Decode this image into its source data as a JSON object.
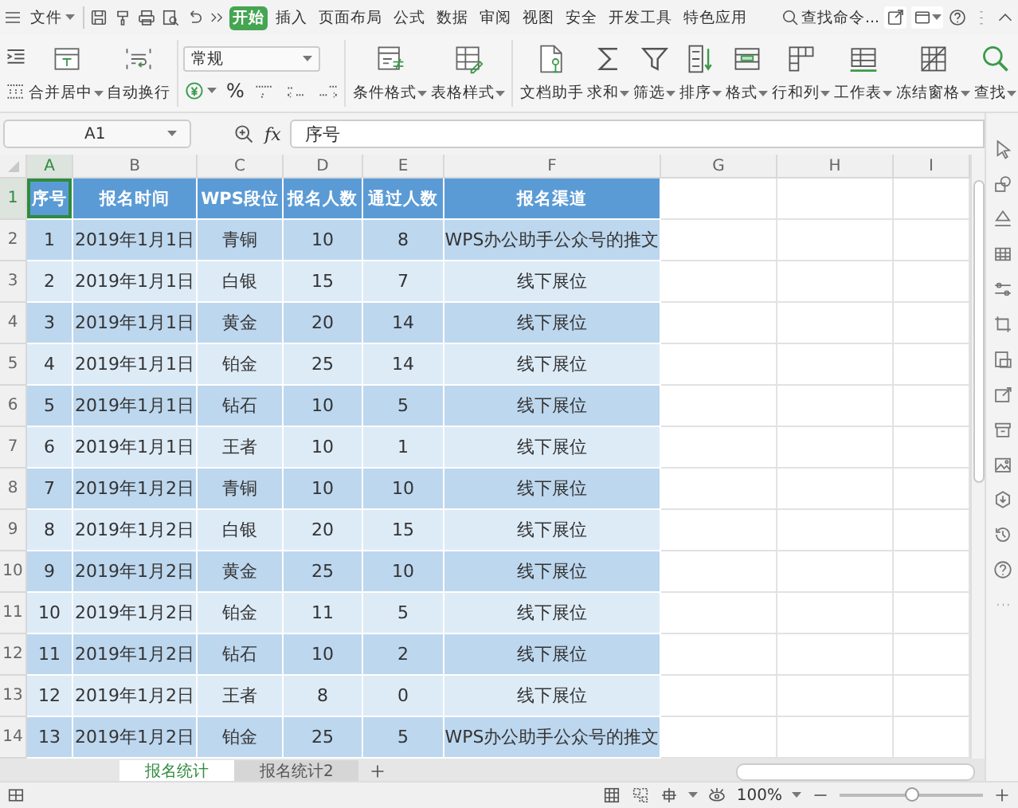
{
  "menu": {
    "file": "文件",
    "tabs": [
      {
        "label": "开始",
        "selected": true
      },
      {
        "label": "插入",
        "selected": false
      },
      {
        "label": "页面布局",
        "selected": false
      },
      {
        "label": "公式",
        "selected": false
      },
      {
        "label": "数据",
        "selected": false
      },
      {
        "label": "审阅",
        "selected": false
      },
      {
        "label": "视图",
        "selected": false
      },
      {
        "label": "安全",
        "selected": false
      },
      {
        "label": "开发工具",
        "selected": false
      },
      {
        "label": "特色应用",
        "selected": false
      }
    ],
    "search": "查找命令..."
  },
  "ribbon": {
    "alignment_buttons": [
      {
        "label": "合并居中",
        "caret": true
      },
      {
        "label": "自动换行",
        "caret": false
      }
    ],
    "number_format": {
      "value": "常规",
      "percent": "%"
    },
    "style_buttons": [
      {
        "label": "条件格式",
        "caret": true
      },
      {
        "label": "表格样式",
        "caret": true
      }
    ],
    "tool_buttons": [
      {
        "label": "文档助手",
        "caret": false
      },
      {
        "label": "求和",
        "caret": true
      },
      {
        "label": "筛选",
        "caret": true
      },
      {
        "label": "排序",
        "caret": true
      },
      {
        "label": "格式",
        "caret": true
      },
      {
        "label": "行和列",
        "caret": true
      },
      {
        "label": "工作表",
        "caret": true
      },
      {
        "label": "冻结窗格",
        "caret": true
      },
      {
        "label": "查找",
        "caret": true
      }
    ]
  },
  "formula_bar": {
    "cell_ref": "A1",
    "fx": "fx",
    "value": "序号"
  },
  "grid": {
    "columns": [
      {
        "label": "A",
        "selected": true
      },
      {
        "label": "B",
        "selected": false
      },
      {
        "label": "C",
        "selected": false
      },
      {
        "label": "D",
        "selected": false
      },
      {
        "label": "E",
        "selected": false
      },
      {
        "label": "F",
        "selected": false
      },
      {
        "label": "G",
        "selected": false
      },
      {
        "label": "H",
        "selected": false
      },
      {
        "label": "I",
        "selected": false
      }
    ],
    "rows": [
      {
        "number": "1",
        "selected": true,
        "kind": "header",
        "cells": [
          "序号",
          "报名时间",
          "WPS段位",
          "报名人数",
          "通过人数",
          "报名渠道"
        ]
      },
      {
        "number": "2",
        "selected": false,
        "kind": "data",
        "cells": [
          "1",
          "2019年1月1日",
          "青铜",
          "10",
          "8",
          "WPS办公助手公众号的推文"
        ]
      },
      {
        "number": "3",
        "selected": false,
        "kind": "data",
        "cells": [
          "2",
          "2019年1月1日",
          "白银",
          "15",
          "7",
          "线下展位"
        ]
      },
      {
        "number": "4",
        "selected": false,
        "kind": "data",
        "cells": [
          "3",
          "2019年1月1日",
          "黄金",
          "20",
          "14",
          "线下展位"
        ]
      },
      {
        "number": "5",
        "selected": false,
        "kind": "data",
        "cells": [
          "4",
          "2019年1月1日",
          "铂金",
          "25",
          "14",
          "线下展位"
        ]
      },
      {
        "number": "6",
        "selected": false,
        "kind": "data",
        "cells": [
          "5",
          "2019年1月1日",
          "钻石",
          "10",
          "5",
          "线下展位"
        ]
      },
      {
        "number": "7",
        "selected": false,
        "kind": "data",
        "cells": [
          "6",
          "2019年1月1日",
          "王者",
          "10",
          "1",
          "线下展位"
        ]
      },
      {
        "number": "8",
        "selected": false,
        "kind": "data",
        "cells": [
          "7",
          "2019年1月2日",
          "青铜",
          "10",
          "10",
          "线下展位"
        ]
      },
      {
        "number": "9",
        "selected": false,
        "kind": "data",
        "cells": [
          "8",
          "2019年1月2日",
          "白银",
          "20",
          "15",
          "线下展位"
        ]
      },
      {
        "number": "10",
        "selected": false,
        "kind": "data",
        "cells": [
          "9",
          "2019年1月2日",
          "黄金",
          "25",
          "10",
          "线下展位"
        ]
      },
      {
        "number": "11",
        "selected": false,
        "kind": "data",
        "cells": [
          "10",
          "2019年1月2日",
          "铂金",
          "11",
          "5",
          "线下展位"
        ]
      },
      {
        "number": "12",
        "selected": false,
        "kind": "data",
        "cells": [
          "11",
          "2019年1月2日",
          "钻石",
          "10",
          "2",
          "线下展位"
        ]
      },
      {
        "number": "13",
        "selected": false,
        "kind": "data",
        "cells": [
          "12",
          "2019年1月2日",
          "王者",
          "8",
          "0",
          "线下展位"
        ]
      },
      {
        "number": "14",
        "selected": false,
        "kind": "data",
        "cells": [
          "13",
          "2019年1月2日",
          "铂金",
          "25",
          "5",
          "WPS办公助手公众号的推文"
        ]
      }
    ]
  },
  "sheet_tabs": [
    {
      "label": "报名统计",
      "selected": true
    },
    {
      "label": "报名统计2",
      "selected": false
    }
  ],
  "status_bar": {
    "zoom": "100%",
    "zoom_slider": {
      "level": 0.5
    }
  }
}
